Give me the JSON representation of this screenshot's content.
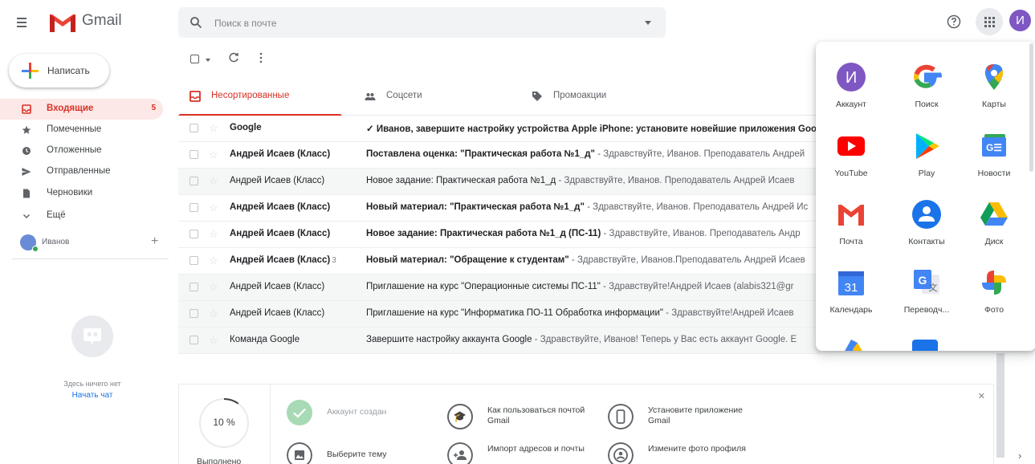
{
  "header": {
    "app_name": "Gmail",
    "search_placeholder": "Поиск в почте",
    "avatar_letter": "И"
  },
  "compose": {
    "label": "Написать"
  },
  "nav": [
    {
      "label": "Входящие",
      "count": "5",
      "icon": "inbox-icon",
      "active": true
    },
    {
      "label": "Помеченные",
      "count": "",
      "icon": "star-icon"
    },
    {
      "label": "Отложенные",
      "count": "",
      "icon": "clock-icon"
    },
    {
      "label": "Отправленные",
      "count": "",
      "icon": "send-icon"
    },
    {
      "label": "Черновики",
      "count": "",
      "icon": "draft-icon"
    },
    {
      "label": "Ещё",
      "count": "",
      "icon": "chevron-down-icon"
    }
  ],
  "user": {
    "name": "Иванов"
  },
  "chat": {
    "empty_text": "Здесь ничего нет",
    "start_chat": "Начать чат"
  },
  "tabs": [
    {
      "label": "Несортированные",
      "icon": "inbox-icon",
      "active": true
    },
    {
      "label": "Соцсети",
      "icon": "people-icon"
    },
    {
      "label": "Промоакции",
      "icon": "tag-icon"
    }
  ],
  "emails": [
    {
      "sender": "Google",
      "count": "",
      "subject": "✓ Иванов, завершите настройку устройства Apple iPhone: установите новейшие приложения Goo",
      "snippet": "",
      "unread": true
    },
    {
      "sender": "Андрей Исаев (Класс)",
      "count": "",
      "subject": "Поставлена оценка: \"Практическая работа №1_д\"",
      "snippet": " - Здравствуйте, Иванов. Преподаватель Андрей",
      "unread": true
    },
    {
      "sender": "Андрей Исаев (Класс)",
      "count": "",
      "subject": "Новое задание: Практическая работа №1_д",
      "snippet": " - Здравствуйте, Иванов. Преподаватель Андрей Исаев",
      "unread": false
    },
    {
      "sender": "Андрей Исаев (Класс)",
      "count": "",
      "subject": "Новый материал: \"Практическая работа №1_д\"",
      "snippet": " - Здравствуйте, Иванов. Преподаватель Андрей Ис",
      "unread": true
    },
    {
      "sender": "Андрей Исаев (Класс)",
      "count": "",
      "subject": "Новое задание: Практическая работа №1_д (ПС-11)",
      "snippet": " - Здравствуйте, Иванов. Преподаватель Андр",
      "unread": true
    },
    {
      "sender": "Андрей Исаев (Класс)",
      "count": "3",
      "subject": "Новый материал: \"Обращение к студентам\"",
      "snippet": " - Здравствуйте, Иванов.Преподаватель Андрей Исаев",
      "unread": true
    },
    {
      "sender": "Андрей Исаев (Класс)",
      "count": "",
      "subject": "Приглашение на курс \"Операционные системы ПС-11\"",
      "snippet": " - Здравствуйте!Андрей Исаев (alabis321@gr",
      "unread": false
    },
    {
      "sender": "Андрей Исаев (Класс)",
      "count": "",
      "subject": "Приглашение на курс \"Информатика ПО-11 Обработка информации\"",
      "snippet": " - Здравствуйте!Андрей Исаев",
      "unread": false
    },
    {
      "sender": "Команда Google",
      "count": "",
      "subject": "Завершите настройку аккаунта Google",
      "snippet": " - Здравствуйте, Иванов! Теперь у Вас есть аккаунт Google. E",
      "unread": false
    }
  ],
  "onboarding": {
    "progress_text": "10 %",
    "progress_value": 0.1,
    "progress_label": "Выполнено",
    "items": [
      {
        "label": "Аккаунт создан",
        "icon": "check-icon",
        "done": true
      },
      {
        "label": "Как пользоваться почтой Gmail",
        "icon": "graduation-cap-icon"
      },
      {
        "label": "Установите приложение Gmail",
        "icon": "phone-icon"
      },
      {
        "label": "Выберите тему",
        "icon": "image-icon"
      },
      {
        "label": "Импорт адресов и почты",
        "icon": "add-person-icon"
      },
      {
        "label": "Измените фото профиля",
        "icon": "profile-icon"
      }
    ]
  },
  "apps": [
    {
      "label": "Аккаунт",
      "icon": "account-icon",
      "glyph": "И"
    },
    {
      "label": "Поиск",
      "icon": "google-search-icon",
      "glyph": ""
    },
    {
      "label": "Карты",
      "icon": "maps-icon",
      "glyph": ""
    },
    {
      "label": "YouTube",
      "icon": "youtube-icon",
      "glyph": ""
    },
    {
      "label": "Play",
      "icon": "play-store-icon",
      "glyph": ""
    },
    {
      "label": "Новости",
      "icon": "news-icon",
      "glyph": ""
    },
    {
      "label": "Почта",
      "icon": "gmail-icon",
      "glyph": ""
    },
    {
      "label": "Контакты",
      "icon": "contacts-icon",
      "glyph": ""
    },
    {
      "label": "Диск",
      "icon": "drive-icon",
      "glyph": ""
    },
    {
      "label": "Календарь",
      "icon": "calendar-icon",
      "glyph": "31"
    },
    {
      "label": "Переводч...",
      "icon": "translate-icon",
      "glyph": ""
    },
    {
      "label": "Фото",
      "icon": "photos-icon",
      "glyph": ""
    }
  ]
}
